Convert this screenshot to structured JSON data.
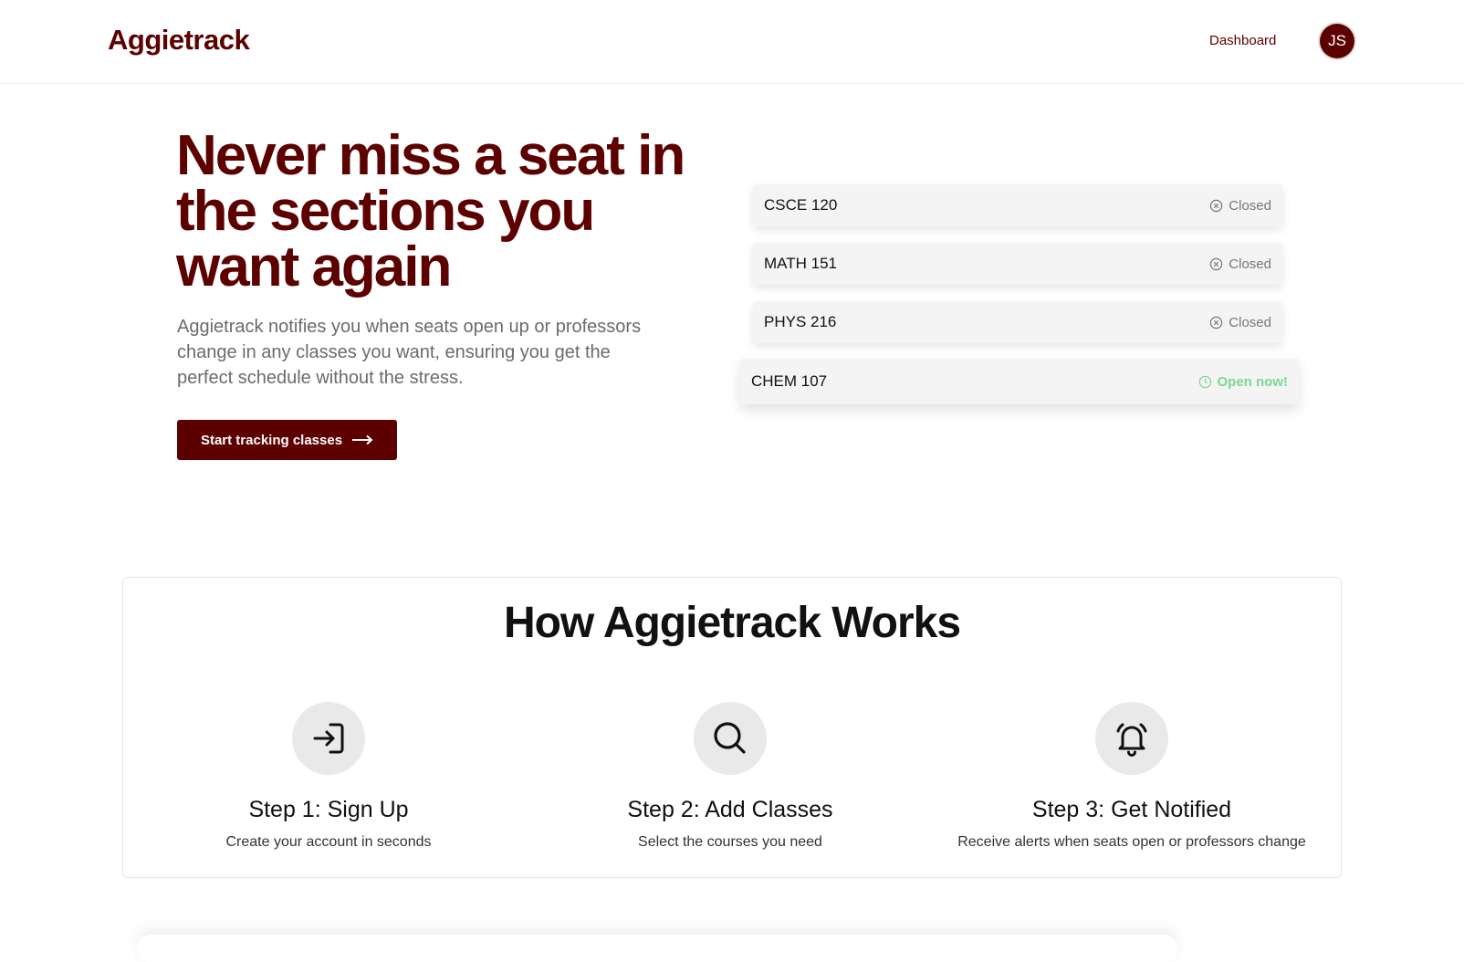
{
  "header": {
    "logo": "Aggietrack",
    "nav_dashboard": "Dashboard",
    "avatar_initials": "JS"
  },
  "hero": {
    "title": "Never miss a seat in the sections you want again",
    "subtitle": "Aggietrack notifies you when seats open up or professors change in any classes you want, ensuring you get the perfect schedule without the stress.",
    "cta_label": "Start tracking classes"
  },
  "classes": [
    {
      "course": "CSCE 120",
      "status": "Closed",
      "icon": "x-circle-icon"
    },
    {
      "course": "MATH 151",
      "status": "Closed",
      "icon": "x-circle-icon"
    },
    {
      "course": "PHYS 216",
      "status": "Closed",
      "icon": "x-circle-icon"
    },
    {
      "course": "CHEM 107",
      "status": "Open now!",
      "icon": "clock-icon"
    }
  ],
  "how": {
    "title": "How Aggietrack Works",
    "steps": [
      {
        "title": "Step 1: Sign Up",
        "desc": "Create your account in seconds",
        "icon": "sign-in-icon"
      },
      {
        "title": "Step 2: Add Classes",
        "desc": "Select the courses you need",
        "icon": "search-icon"
      },
      {
        "title": "Step 3: Get Notified",
        "desc": "Receive alerts when seats open or professors change",
        "icon": "bell-ringing-icon"
      }
    ]
  },
  "colors": {
    "brand": "#5c0000",
    "open_status": "#7ed597",
    "closed_status": "#777777"
  }
}
